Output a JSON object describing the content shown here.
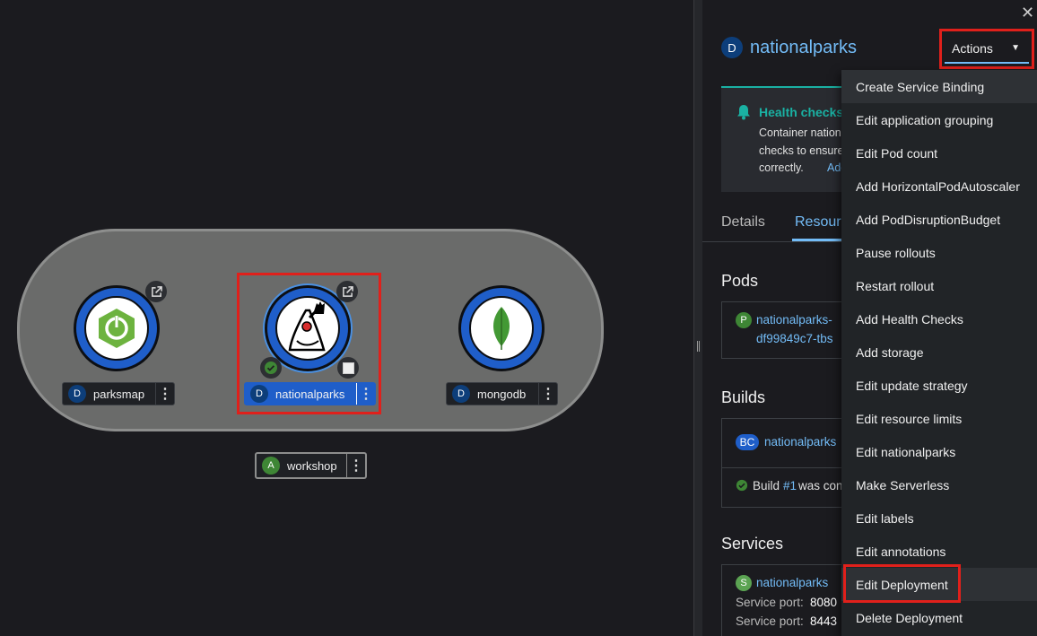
{
  "topology": {
    "nodes": [
      {
        "name": "parksmap",
        "badge": "D"
      },
      {
        "name": "nationalparks",
        "badge": "D"
      },
      {
        "name": "mongodb",
        "badge": "D"
      }
    ],
    "app_group": {
      "name": "workshop",
      "badge": "A"
    }
  },
  "panel": {
    "close_glyph": "✕",
    "title_badge": "D",
    "title": "nationalparks",
    "actions_label": "Actions",
    "alert": {
      "title": "Health checks",
      "text_line1": "Container nation",
      "text_line2": "checks to ensure",
      "text_line3": "correctly.",
      "link": "Add h"
    },
    "tabs": [
      "Details",
      "Resource"
    ],
    "pods": {
      "heading": "Pods",
      "badge": "P",
      "name_line1": "nationalparks-",
      "name_line2": "df99849c7-tbs"
    },
    "builds": {
      "heading": "Builds",
      "badge": "BC",
      "name": "nationalparks",
      "status_prefix": "Build",
      "build_link": "#1",
      "status_suffix": "was con"
    },
    "services": {
      "heading": "Services",
      "badge": "S",
      "name": "nationalparks",
      "port_label_1": "Service port:",
      "port_value_1": "8080",
      "port_label_2": "Service port:",
      "port_value_2": "8443"
    }
  },
  "actions_menu": [
    "Create Service Binding",
    "Edit application grouping",
    "Edit Pod count",
    "Add HorizontalPodAutoscaler",
    "Add PodDisruptionBudget",
    "Pause rollouts",
    "Restart rollout",
    "Add Health Checks",
    "Add storage",
    "Edit update strategy",
    "Edit resource limits",
    "Edit nationalparks",
    "Make Serverless",
    "Edit labels",
    "Edit annotations",
    "Edit Deployment",
    "Delete Deployment"
  ],
  "colors": {
    "ring_blue": "#1f5ec9",
    "highlight_red": "#e0201b",
    "link_blue": "#73bcf7",
    "alert_teal": "#1ab1a3"
  }
}
